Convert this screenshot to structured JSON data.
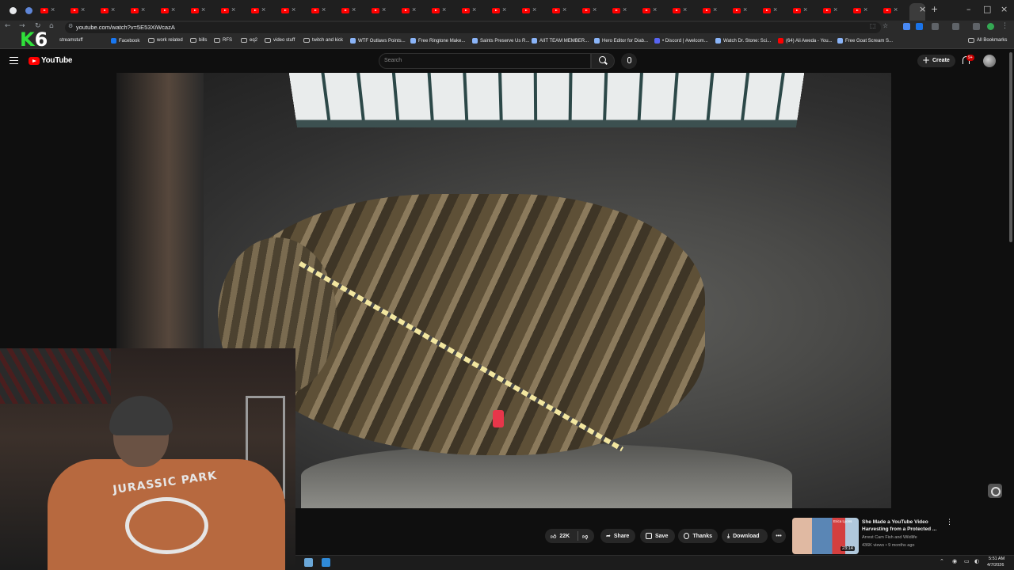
{
  "browser": {
    "url": "youtube.com/watch?v=5E53XiWcazA",
    "bookmarks": [
      {
        "label": "streamstuff",
        "icon": "stream-icon"
      },
      {
        "label": "Facebook",
        "icon": "facebook-icon"
      },
      {
        "label": "work related",
        "icon": "folder-icon"
      },
      {
        "label": "bills",
        "icon": "folder-icon"
      },
      {
        "label": "RFS",
        "icon": "folder-icon"
      },
      {
        "label": "eq2",
        "icon": "folder-icon"
      },
      {
        "label": "video stuff",
        "icon": "folder-icon"
      },
      {
        "label": "twitch and kick",
        "icon": "folder-icon"
      },
      {
        "label": "WTF Outlaws Points...",
        "icon": "site-icon"
      },
      {
        "label": "Free Ringtone Make...",
        "icon": "site-icon"
      },
      {
        "label": "Saints Preserve Us R...",
        "icon": "site-icon"
      },
      {
        "label": "AIIT TEAM MEMBER...",
        "icon": "site-icon"
      },
      {
        "label": "Hero Editor for Diab...",
        "icon": "site-icon"
      },
      {
        "label": "• Discord | #welcom...",
        "icon": "discord-icon"
      },
      {
        "label": "Watch Dr. Stone: Sci...",
        "icon": "site-icon"
      },
      {
        "label": "(64) Ali Aweda - You...",
        "icon": "youtube-icon"
      },
      {
        "label": "Free Goat Scream S...",
        "icon": "site-icon"
      }
    ],
    "all_bookmarks": "All Bookmarks"
  },
  "overlay": {
    "k_letter": "K",
    "number": "6"
  },
  "header": {
    "logo_text": "YouTube",
    "search_placeholder": "Search",
    "create_label": "Create",
    "notification_badge": "9+"
  },
  "actions": {
    "like_count": "22K",
    "share_label": "Share",
    "save_label": "Save",
    "thanks_label": "Thanks",
    "download_label": "Download"
  },
  "related": {
    "title": "She Made a YouTube Video Harvesting from a Protected ...",
    "channel": "Arrest Cam Fish and Wildlife",
    "meta": "436K views • 9 months ago",
    "duration": "23:14",
    "thumb_tag": "Erica Lyons"
  },
  "webcam": {
    "shirt_text": "JURASSIC PARK"
  },
  "taskbar": {
    "time": "5:51 AM",
    "date": "4/7/2026"
  },
  "colors": {
    "youtube_red": "#ff0000",
    "k6_green": "#2fe03a",
    "bg": "#0f0f0f",
    "pill": "#272727"
  }
}
